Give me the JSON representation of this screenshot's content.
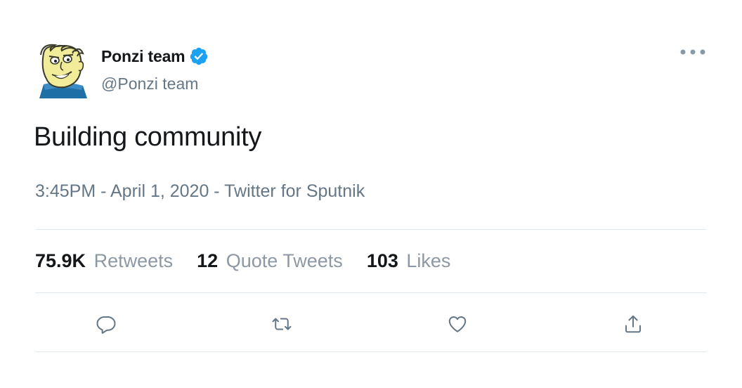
{
  "author": {
    "display_name": "Ponzi team",
    "handle": "@Ponzi team",
    "verified": true
  },
  "tweet": {
    "text": "Building community",
    "meta": "3:45PM - April 1, 2020 - Twitter for Sputnik"
  },
  "stats": {
    "retweets": {
      "count": "75.9K",
      "label": "Retweets"
    },
    "quotes": {
      "count": "12",
      "label": "Quote Tweets"
    },
    "likes": {
      "count": "103",
      "label": "Likes"
    }
  },
  "colors": {
    "verified_blue": "#1da1f2",
    "secondary_text": "#657786",
    "icon_gray": "#657786",
    "divider": "#e1e8ed"
  },
  "icons": {
    "more": "more-dots-icon",
    "reply": "reply-icon",
    "retweet": "retweet-icon",
    "like": "heart-icon",
    "share": "share-icon"
  }
}
